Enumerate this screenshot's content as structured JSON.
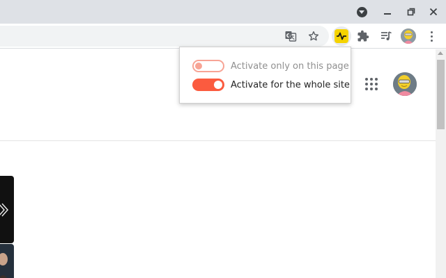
{
  "colors": {
    "titlebar_bg": "#dee1e6",
    "toolbar_bg": "#ffffff",
    "extension_icon_bg": "#f5d300",
    "toggle_on": "#fb5b3f",
    "toggle_off_border": "#f7a495"
  },
  "titlebar": {
    "icons": [
      "tab-search-icon",
      "minimize-icon",
      "maximize-icon",
      "close-icon"
    ]
  },
  "toolbar": {
    "icons": [
      "translate-icon",
      "bookmark-star-icon",
      "pulse-extension-icon",
      "extensions-puzzle-icon",
      "media-control-icon",
      "profile-avatar",
      "kebab-menu-icon"
    ]
  },
  "popup": {
    "options": [
      {
        "label": "Activate only on this page",
        "enabled": false
      },
      {
        "label": "Activate for the whole site",
        "enabled": true
      }
    ]
  }
}
